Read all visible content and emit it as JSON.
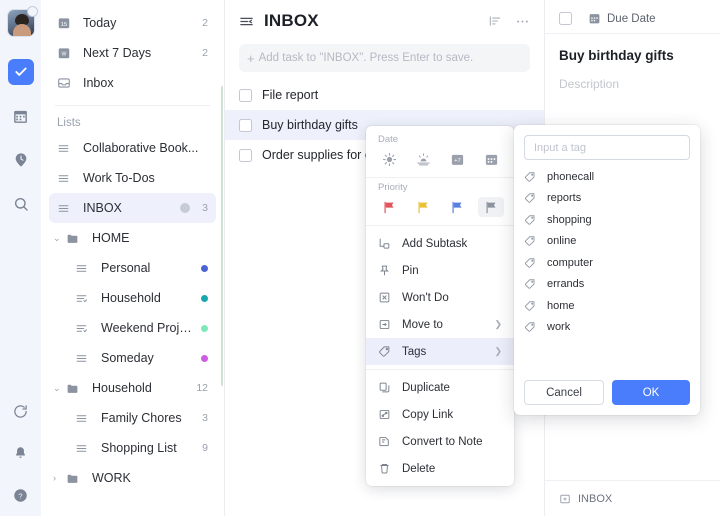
{
  "rail": {
    "avatar_name": "user-avatar",
    "icons": [
      {
        "name": "tasks-check-icon",
        "glyph": "check",
        "active": true
      },
      {
        "name": "calendar-icon",
        "glyph": "calendar",
        "active": false
      },
      {
        "name": "pomodoro-clock-icon",
        "glyph": "clock-pin",
        "active": false
      },
      {
        "name": "search-icon",
        "glyph": "search",
        "active": false
      }
    ],
    "bottom_icons": [
      {
        "name": "sync-icon",
        "glyph": "sync"
      },
      {
        "name": "notification-bell-icon",
        "glyph": "bell"
      },
      {
        "name": "help-icon",
        "glyph": "help"
      }
    ]
  },
  "sidebar": {
    "smart_lists": [
      {
        "label": "Today",
        "count": "2",
        "icon": "calendar-today-icon"
      },
      {
        "label": "Next 7 Days",
        "count": "2",
        "icon": "calendar-week-icon"
      },
      {
        "label": "Inbox",
        "count": "",
        "icon": "inbox-icon"
      }
    ],
    "section_title": "Lists",
    "lists": [
      {
        "label": "Collaborative Book...",
        "count": "",
        "icon": "list-icon",
        "dot": "",
        "selected": false,
        "indent": "root"
      },
      {
        "label": "Work To-Dos",
        "count": "",
        "icon": "list-icon",
        "dot": "",
        "selected": false,
        "indent": "root"
      },
      {
        "label": "INBOX",
        "count": "3",
        "icon": "list-icon",
        "dot": "",
        "selected": true,
        "indent": "root",
        "gear": true
      }
    ],
    "folders": [
      {
        "label": "HOME",
        "count": "",
        "caret": "⌄",
        "expanded": true,
        "children": [
          {
            "label": "Personal",
            "count": "",
            "dot": "#4a63d6",
            "icon": "list-icon"
          },
          {
            "label": "Household",
            "count": "",
            "dot": "#17a8ad",
            "icon": "checklist-icon"
          },
          {
            "label": "Weekend Projects",
            "count": "",
            "dot": "#7ee8b8",
            "icon": "checklist-icon"
          },
          {
            "label": "Someday",
            "count": "",
            "dot": "#cc5ce0",
            "icon": "list-icon"
          }
        ]
      },
      {
        "label": "Household",
        "count": "12",
        "caret": "⌄",
        "expanded": true,
        "children": [
          {
            "label": "Family Chores",
            "count": "3",
            "dot": "",
            "icon": "list-icon"
          },
          {
            "label": "Shopping List",
            "count": "9",
            "dot": "",
            "icon": "list-icon"
          }
        ]
      },
      {
        "label": "WORK",
        "count": "",
        "caret": "›",
        "expanded": false,
        "children": []
      }
    ]
  },
  "tasklist": {
    "title": "INBOX",
    "menu_icon": "collapse-sidebar-icon",
    "sort_icon": "sort-icon",
    "more_icon": "more-options-icon",
    "add_placeholder": "Add task to \"INBOX\". Press Enter to save.",
    "tasks": [
      {
        "label": "File report",
        "selected": false
      },
      {
        "label": "Buy birthday gifts",
        "selected": true
      },
      {
        "label": "Order supplies for ca",
        "selected": false
      }
    ]
  },
  "detail": {
    "due_date_label": "Due Date",
    "title": "Buy birthday gifts",
    "description_placeholder": "Description",
    "footer_list": "INBOX"
  },
  "context_menu": {
    "date_label": "Date",
    "date_options": [
      {
        "name": "today-sun-icon",
        "selected": false
      },
      {
        "name": "tomorrow-sunset-icon",
        "selected": false
      },
      {
        "name": "next-week-plus7-icon",
        "selected": false
      },
      {
        "name": "custom-date-calendar-icon",
        "selected": false
      }
    ],
    "priority_label": "Priority",
    "priority_options": [
      {
        "name": "priority-high-flag-icon",
        "color": "#e0565b",
        "selected": false
      },
      {
        "name": "priority-medium-flag-icon",
        "color": "#e9c038",
        "selected": false
      },
      {
        "name": "priority-low-flag-icon",
        "color": "#5a7fe0",
        "selected": false
      },
      {
        "name": "priority-none-flag-icon",
        "color": "#8d939e",
        "selected": true
      }
    ],
    "items": [
      {
        "label": "Add Subtask",
        "icon": "add-subtask-icon",
        "submenu": false,
        "highlighted": false
      },
      {
        "label": "Pin",
        "icon": "pin-icon",
        "submenu": false,
        "highlighted": false
      },
      {
        "label": "Won't Do",
        "icon": "wont-do-icon",
        "submenu": false,
        "highlighted": false
      },
      {
        "label": "Move to",
        "icon": "move-to-icon",
        "submenu": true,
        "highlighted": false
      },
      {
        "label": "Tags",
        "icon": "tag-icon",
        "submenu": true,
        "highlighted": true
      },
      {
        "label": "Duplicate",
        "icon": "duplicate-icon",
        "submenu": false,
        "highlighted": false
      },
      {
        "label": "Copy Link",
        "icon": "copy-link-icon",
        "submenu": false,
        "highlighted": false
      },
      {
        "label": "Convert to Note",
        "icon": "convert-to-note-icon",
        "submenu": false,
        "highlighted": false
      },
      {
        "label": "Delete",
        "icon": "delete-icon",
        "submenu": false,
        "highlighted": false
      }
    ]
  },
  "tag_popup": {
    "input_placeholder": "Input a tag",
    "input_value": "",
    "tags": [
      {
        "label": "phonecall"
      },
      {
        "label": "reports"
      },
      {
        "label": "shopping"
      },
      {
        "label": "online"
      },
      {
        "label": "computer"
      },
      {
        "label": "errands"
      },
      {
        "label": "home"
      },
      {
        "label": "work"
      }
    ],
    "cancel_label": "Cancel",
    "ok_label": "OK"
  },
  "colors": {
    "accent": "#4a7dfc",
    "selection": "#eef1fb",
    "rail_bg": "#f2f5fb"
  }
}
